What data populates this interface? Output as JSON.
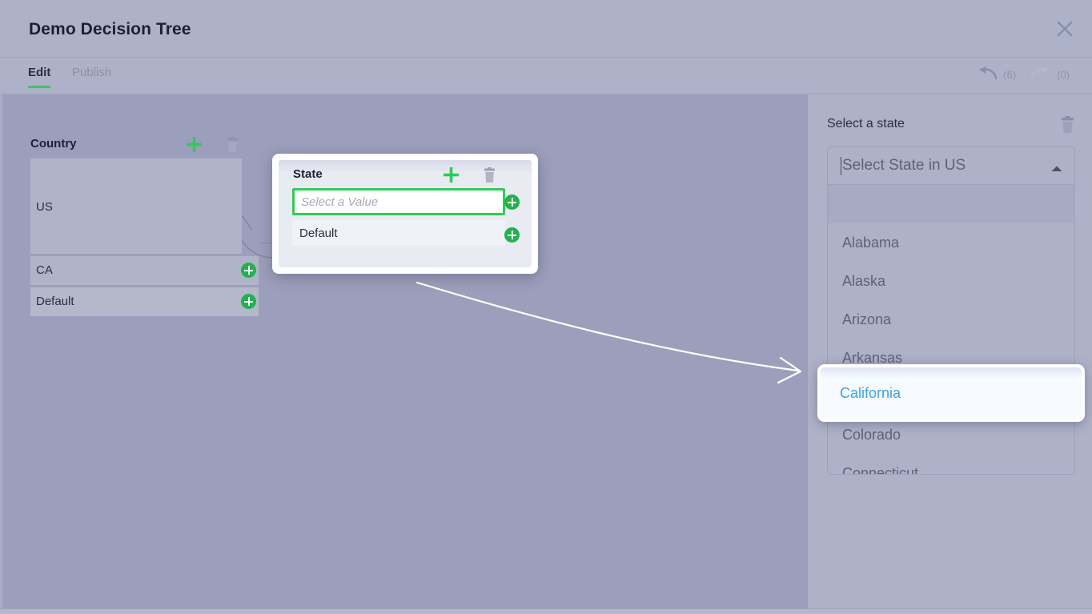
{
  "window": {
    "title": "Demo Decision Tree",
    "close_icon": "close-icon"
  },
  "tabs": [
    {
      "label": "Edit",
      "active": true
    },
    {
      "label": "Publish",
      "active": false
    }
  ],
  "history": {
    "undo_icon": "undo-arrow-icon",
    "undo_count": "(6)",
    "redo_icon": "redo-arrow-icon",
    "redo_count": "(0)"
  },
  "canvas": {
    "nodes": [
      {
        "title": "Country",
        "add_icon": "plus-icon",
        "delete_icon": "trash-icon",
        "rows": [
          {
            "label": "US",
            "selected": true
          },
          {
            "label": "CA",
            "selected": false
          },
          {
            "label": "Default",
            "selected": false
          }
        ]
      },
      {
        "title": "State",
        "add_icon": "plus-icon",
        "delete_icon": "trash-icon",
        "value_placeholder": "Select a Value",
        "value": "",
        "rows": [
          {
            "label": "Default",
            "selected": false
          }
        ]
      }
    ]
  },
  "right_panel": {
    "title": "Select a state",
    "delete_icon": "trash-icon",
    "dropdown": {
      "header_text": "Select State in US",
      "caret_icon": "chevron-up-icon",
      "expanded": true,
      "selected_value": "California",
      "options": [
        "",
        "Alabama",
        "Alaska",
        "Arizona",
        "Arkansas",
        "California",
        "Colorado",
        "Connecticut"
      ]
    }
  },
  "colors": {
    "accent_green": "#2ecc57",
    "selected_blue": "#3ba3f5",
    "app_background": "#aeb2c8",
    "canvas_background": "#9c9fbb"
  }
}
